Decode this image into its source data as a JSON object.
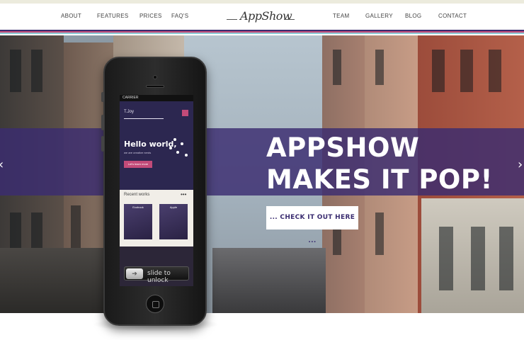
{
  "nav": {
    "left": [
      "ABOUT",
      "FEATURES",
      "PRICES",
      "FAQ'S"
    ],
    "right": [
      "TEAM",
      "GALLERY",
      "BLOG",
      "CONTACT"
    ]
  },
  "logo": "AppShow",
  "stripe_colors": [
    "#3a2c70",
    "#c24b79",
    "#8ccbd6"
  ],
  "hero": {
    "headline_line1": "APPSHOW",
    "headline_line2": "MAKES IT POP!",
    "cta_label": "... CHECK IT OUT HERE ...",
    "prev_arrow": "‹",
    "next_arrow": "›",
    "band_color": "#3a2c70"
  },
  "phone": {
    "carrier": "CARRIER",
    "brand": "T.Joy",
    "hello": "Hello world,",
    "hello_sub": "we are creative nerds",
    "learn_button": "Let's learn more",
    "works_title": "Recent works",
    "works_dots": "•••",
    "thumb1": "Ecobook",
    "thumb2": "Apple",
    "slide_text": "slide to unlock",
    "slide_icon": "arrow-right-icon"
  }
}
